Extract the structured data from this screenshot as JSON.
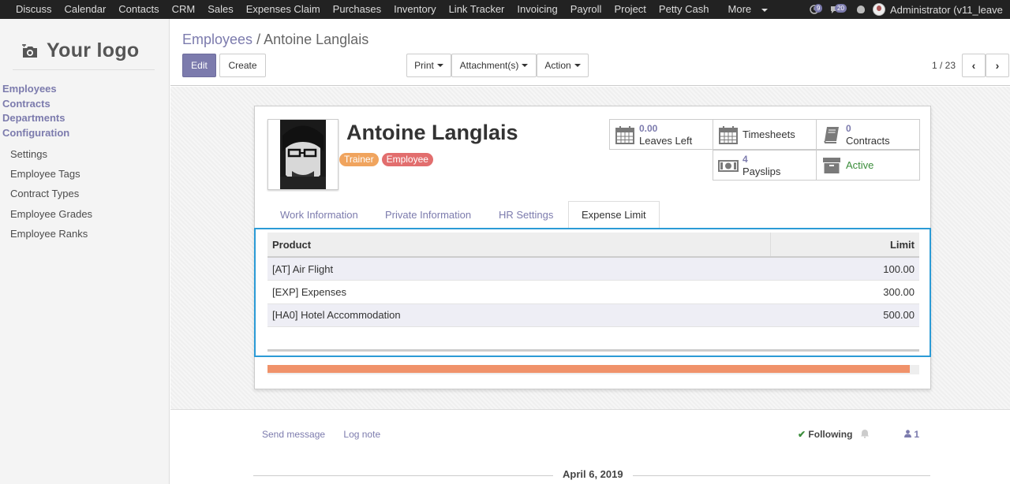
{
  "topbar": {
    "menu": [
      "Discuss",
      "Calendar",
      "Contacts",
      "CRM",
      "Sales",
      "Expenses Claim",
      "Purchases",
      "Inventory",
      "Link Tracker",
      "Invoicing",
      "Payroll",
      "Project",
      "Petty Cash"
    ],
    "more_label": "More",
    "activity_count": "9",
    "messages_count": "20",
    "user_label": "Administrator (v11_leave"
  },
  "sidebar": {
    "logo_text": "Your logo",
    "main_items": [
      "Employees",
      "Contracts",
      "Departments",
      "Configuration"
    ],
    "sub_items": [
      "Settings",
      "Employee Tags",
      "Contract Types",
      "Employee Grades",
      "Employee Ranks"
    ]
  },
  "control_panel": {
    "breadcrumb_parent": "Employees",
    "breadcrumb_separator": "/",
    "breadcrumb_current": "Antoine Langlais",
    "edit_label": "Edit",
    "create_label": "Create",
    "print_label": "Print",
    "attachments_label": "Attachment(s)",
    "action_label": "Action",
    "pager": "1 / 23"
  },
  "employee": {
    "name": "Antoine Langlais",
    "tags": [
      {
        "label": "Trainer",
        "color": "#f0a45e"
      },
      {
        "label": "Employee",
        "color": "#e26e6e"
      }
    ]
  },
  "stat_buttons": {
    "leaves": {
      "value": "0.00",
      "label": "Leaves Left",
      "icon": "calendar-icon"
    },
    "timesheets": {
      "label": "Timesheets",
      "icon": "calendar-icon"
    },
    "contracts": {
      "value": "0",
      "label": "Contracts",
      "icon": "book-icon"
    },
    "payslips": {
      "value": "4",
      "label": "Payslips",
      "icon": "money-icon"
    },
    "active": {
      "label": "Active",
      "icon": "archive-icon"
    }
  },
  "tabs": [
    "Work Information",
    "Private Information",
    "HR Settings",
    "Expense Limit"
  ],
  "active_tab": "Expense Limit",
  "expense_table": {
    "headers": {
      "product": "Product",
      "limit": "Limit"
    },
    "rows": [
      {
        "product": "[AT] Air Flight",
        "limit": "100.00"
      },
      {
        "product": "[EXP] Expenses",
        "limit": "300.00"
      },
      {
        "product": "[HA0] Hotel Accommodation",
        "limit": "500.00"
      }
    ]
  },
  "progress_fraction": 0.986,
  "chatter": {
    "send_message": "Send message",
    "log_note": "Log note",
    "following": "Following",
    "followers_count": "1",
    "date_separator": "April 6, 2019"
  },
  "colors": {
    "brand": "#7c7bad",
    "focus_border": "#2b9bd6",
    "progress_fill": "#f0926a",
    "active_green": "#3b8d3b"
  }
}
